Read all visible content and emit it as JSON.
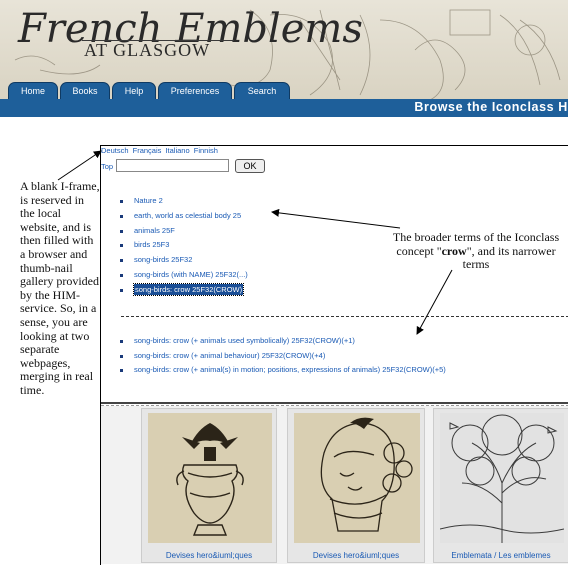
{
  "banner": {
    "logo_title": "French Emblems",
    "logo_subtitle": "AT GLASGOW"
  },
  "tabs": [
    {
      "label": "Home"
    },
    {
      "label": "Books"
    },
    {
      "label": "Help"
    },
    {
      "label": "Preferences"
    },
    {
      "label": "Search"
    }
  ],
  "bar_title": "Browse the Iconclass Hi",
  "iframe": {
    "languages": [
      "Deutsch",
      "Français",
      "Italiano",
      "Finnish"
    ],
    "top_label": "Top",
    "top_input_value": "",
    "ok_label": "OK",
    "hierarchy": [
      "Nature 2",
      "earth, world as celestial body 25",
      "animals 25F",
      "birds 25F3",
      "song-birds 25F32",
      "song-birds (with NAME) 25F32(...)",
      "song-birds: crow 25F32(CROW)"
    ],
    "narrower": [
      "song-birds: crow (+ animals used symbolically) 25F32(CROW)(+1)",
      "song-birds: crow (+ animal behaviour) 25F32(CROW)(+4)",
      "song-birds: crow (+ animal(s) in motion; positions, expressions of animals) 25F32(CROW)(+5)"
    ],
    "thumbnails": [
      {
        "caption": "Devises hero&iuml;ques"
      },
      {
        "caption": "Devises hero&iuml;ques"
      },
      {
        "caption": "Emblemata / Les emblemes"
      }
    ]
  },
  "annotations": {
    "left": "A blank I-frame, is reserved in the local website, and is then filled with a browser and thumb-nail gallery provided by the HIM-service. So, in a sense, you are looking at two separate webpages, merging in real time.",
    "right_prefix": "The broader terms of the Iconclass concept \"",
    "right_term": "crow",
    "right_suffix": "\", and its narrower terms"
  }
}
